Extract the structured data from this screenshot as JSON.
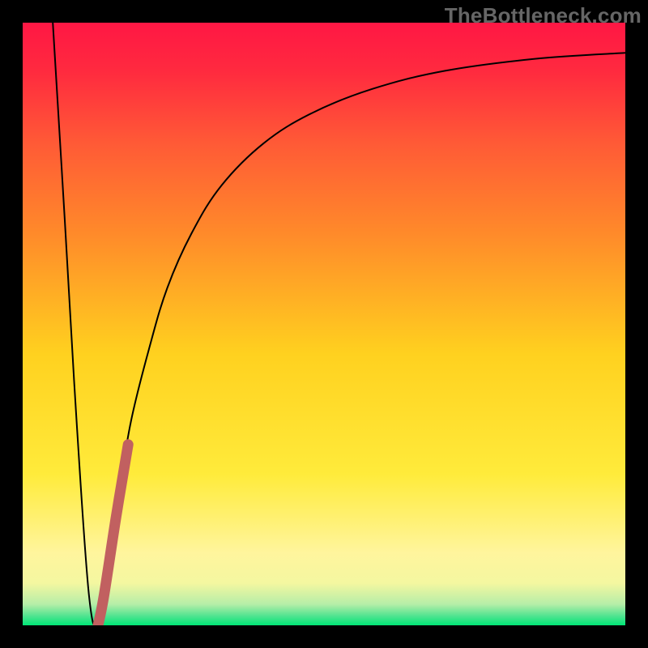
{
  "watermark": "TheBottleneck.com",
  "chart_data": {
    "type": "line",
    "title": "",
    "xlabel": "",
    "ylabel": "",
    "xlim": [
      0,
      100
    ],
    "ylim": [
      0,
      100
    ],
    "grid": false,
    "legend": false,
    "series": [
      {
        "name": "bottleneck-curve",
        "x": [
          5,
          7,
          9,
          11,
          12.5,
          14,
          16,
          18,
          21,
          24,
          28,
          33,
          40,
          48,
          58,
          70,
          85,
          100
        ],
        "y": [
          100,
          67,
          33,
          5,
          0,
          8,
          22,
          34,
          46,
          56,
          65,
          73,
          80,
          85,
          89,
          92,
          94,
          95
        ],
        "color": "#000000"
      },
      {
        "name": "highlight-segment",
        "x": [
          12.5,
          13.5,
          15.5,
          17.5
        ],
        "y": [
          0,
          5,
          18,
          30
        ],
        "color": "#c16060"
      }
    ],
    "background_gradient": {
      "stops": [
        {
          "offset": 0.0,
          "color": "#ff1744"
        },
        {
          "offset": 0.08,
          "color": "#ff2a3f"
        },
        {
          "offset": 0.2,
          "color": "#ff5a36"
        },
        {
          "offset": 0.35,
          "color": "#ff8a2a"
        },
        {
          "offset": 0.55,
          "color": "#ffd11f"
        },
        {
          "offset": 0.75,
          "color": "#ffeb3b"
        },
        {
          "offset": 0.88,
          "color": "#fff59d"
        },
        {
          "offset": 0.93,
          "color": "#f4f7a0"
        },
        {
          "offset": 0.965,
          "color": "#b6eea8"
        },
        {
          "offset": 0.985,
          "color": "#4de38f"
        },
        {
          "offset": 1.0,
          "color": "#00e676"
        }
      ]
    }
  }
}
